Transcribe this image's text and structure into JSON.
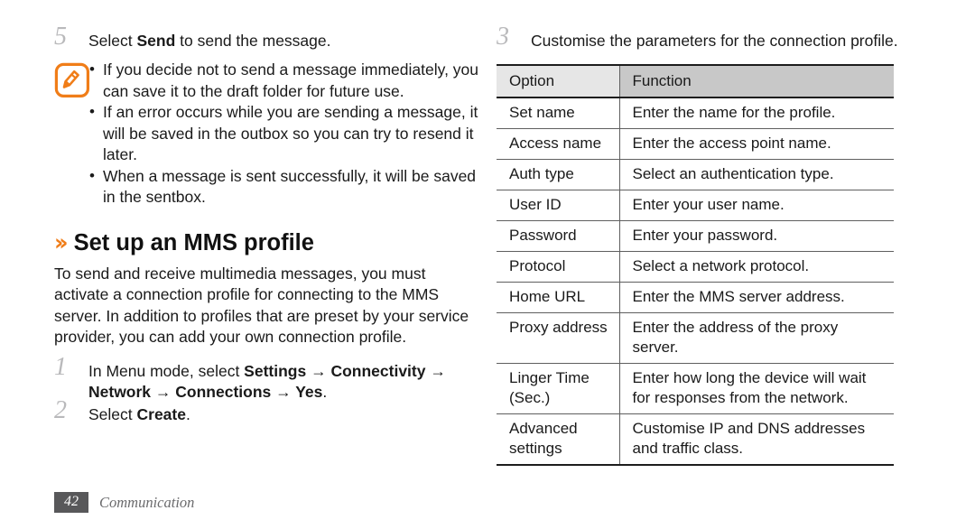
{
  "left_column": {
    "step5": {
      "number": "5",
      "text_before": "Select ",
      "bold": "Send",
      "text_after": " to send the message."
    },
    "note": {
      "icon": "note-pencil-icon",
      "bullets": [
        "If you decide not to send a message immediately, you can save it to the draft folder for future use.",
        "If an error occurs while you are sending a message, it will be saved in the outbox so you can try to resend it later.",
        "When a message is sent successfully, it will be saved in the sentbox."
      ]
    },
    "section": {
      "chevron": "››",
      "title": "Set up an MMS profile",
      "paragraph": "To send and receive multimedia messages, you must activate a connection profile for connecting to the MMS server. In addition to profiles that are preset by your service provider, you can add your own connection profile."
    },
    "step1": {
      "number": "1",
      "p1": "In Menu mode, select ",
      "b1": "Settings",
      "a1": " → ",
      "b2": "Connectivity",
      "a2": " → ",
      "b3": "Network",
      "a3": " → ",
      "b4": "Connections",
      "a4": " → ",
      "b5": "Yes",
      "p2": "."
    },
    "step2": {
      "number": "2",
      "text_before": "Select ",
      "bold": "Create",
      "text_after": "."
    }
  },
  "right_column": {
    "step3": {
      "number": "3",
      "text": "Customise the parameters for the connection profile."
    },
    "table": {
      "headers": [
        "Option",
        "Function"
      ],
      "rows": [
        [
          "Set name",
          "Enter the name for the profile."
        ],
        [
          "Access name",
          "Enter the access point name."
        ],
        [
          "Auth type",
          "Select an authentication type."
        ],
        [
          "User ID",
          "Enter your user name."
        ],
        [
          "Password",
          "Enter your password."
        ],
        [
          "Protocol",
          "Select a network protocol."
        ],
        [
          "Home URL",
          "Enter the MMS server address."
        ],
        [
          "Proxy address",
          "Enter the address of the proxy server."
        ],
        [
          "Linger Time (Sec.)",
          "Enter how long the device will wait for responses from the network."
        ],
        [
          "Advanced settings",
          "Customise IP and DNS addresses and traffic class."
        ]
      ]
    }
  },
  "footer": {
    "page_number": "42",
    "chapter": "Communication"
  },
  "colors": {
    "accent_orange": "#f07d18",
    "header_light": "#e6e6e6",
    "header_dark": "#c8c8c8",
    "badge_gray": "#58585a",
    "step_number_gray": "#b9b9bb"
  }
}
